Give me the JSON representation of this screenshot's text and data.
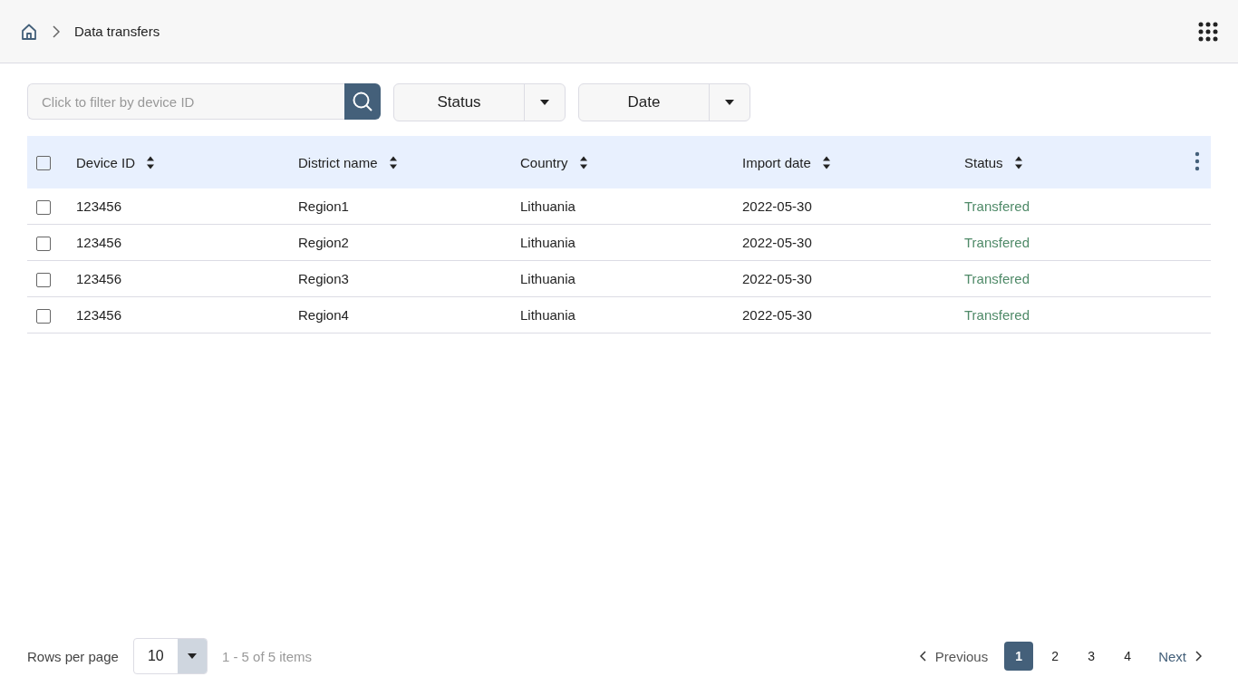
{
  "breadcrumb": {
    "current": "Data transfers"
  },
  "filters": {
    "search": {
      "placeholder": "Click to filter by device ID"
    },
    "dropdowns": [
      {
        "label": "Status"
      },
      {
        "label": "Date"
      }
    ]
  },
  "table": {
    "select_all": {
      "checked": false
    },
    "columns": [
      "Device ID",
      "District name",
      "Country",
      "Import date",
      "Status"
    ],
    "rows": [
      {
        "checked": false,
        "cells": [
          "123456",
          "Region1",
          "Lithuania",
          "2022-05-30",
          "Transfered"
        ]
      },
      {
        "checked": false,
        "cells": [
          "123456",
          "Region2",
          "Lithuania",
          "2022-05-30",
          "Transfered"
        ]
      },
      {
        "checked": false,
        "cells": [
          "123456",
          "Region3",
          "Lithuania",
          "2022-05-30",
          "Transfered"
        ]
      },
      {
        "checked": false,
        "cells": [
          "123456",
          "Region4",
          "Lithuania",
          "2022-05-30",
          "Transfered"
        ]
      }
    ]
  },
  "footer": {
    "rows_per_page_label": "Rows per page",
    "rows_per_page": "10",
    "range": "1 - 5 of 5 items",
    "previous": "Previous",
    "next": "Next",
    "pages": [
      {
        "label": "1",
        "selected": true
      },
      {
        "label": "2",
        "selected": false
      },
      {
        "label": "3",
        "selected": false
      },
      {
        "label": "4",
        "selected": false
      }
    ]
  }
}
